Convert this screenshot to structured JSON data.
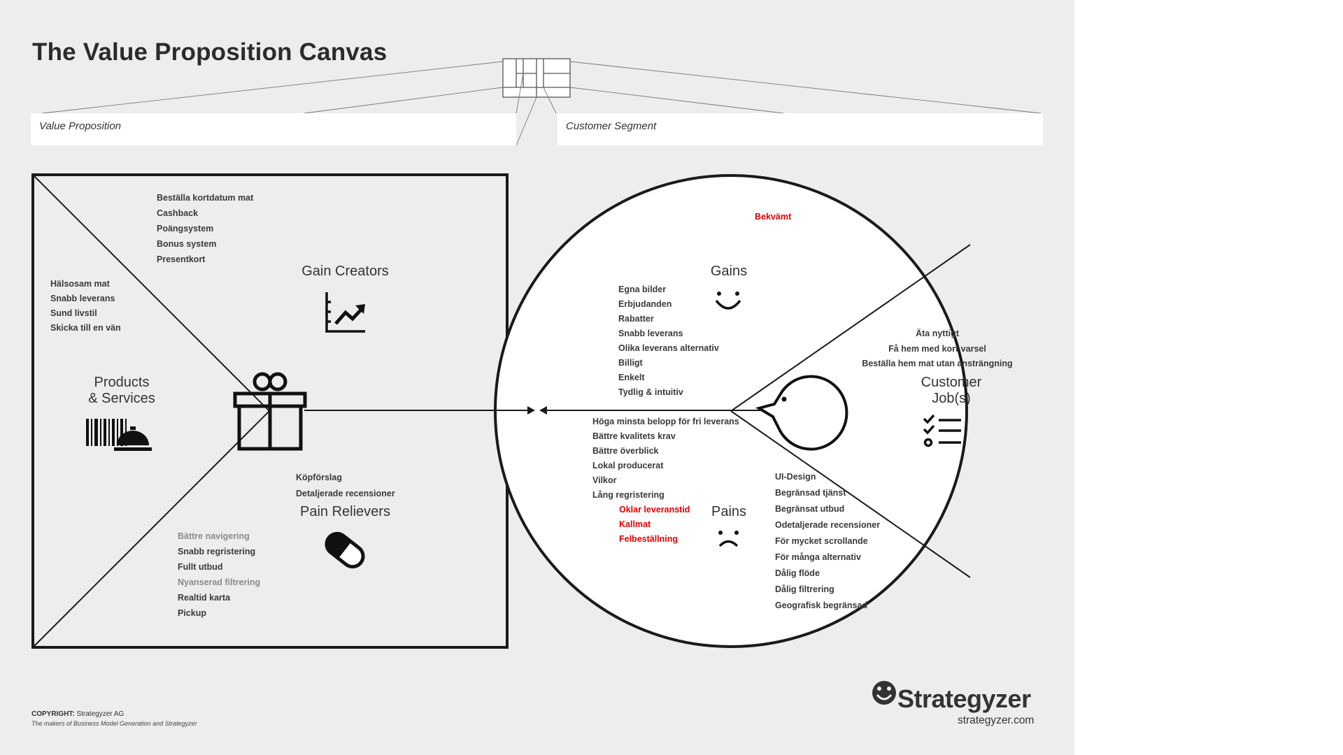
{
  "title": "The Value Proposition Canvas",
  "segments": {
    "value_proposition": "Value Proposition",
    "customer_segment": "Customer Segment"
  },
  "gain_creators": {
    "label": "Gain Creators",
    "top_items": [
      "Beställa kortdatum mat",
      "Cashback",
      "Poängsystem",
      "Bonus system",
      "Presentkort"
    ]
  },
  "products_services": {
    "label_line1": "Products",
    "label_line2": "& Services",
    "items": [
      "Hälsosam mat",
      "Snabb leverans",
      "Sund livstil",
      "Skicka till en vän"
    ]
  },
  "pain_relievers": {
    "label": "Pain Relievers",
    "top_items": [
      "Köpförslag",
      "Detaljerade recensioner"
    ],
    "items": [
      {
        "text": "Bättre navigering",
        "tone": "gray"
      },
      {
        "text": "Snabb regristering",
        "tone": "normal"
      },
      {
        "text": "Fullt utbud",
        "tone": "normal"
      },
      {
        "text": "Nyanserad filtrering",
        "tone": "gray"
      },
      {
        "text": "Realtid karta",
        "tone": "normal"
      },
      {
        "text": "Pickup",
        "tone": "normal"
      }
    ]
  },
  "gains": {
    "label": "Gains",
    "highlight": "Bekvämt",
    "items": [
      "Egna bilder",
      "Erbjudanden",
      "Rabatter",
      "Snabb leverans",
      "Olika leverans alternativ",
      "Billigt",
      "Enkelt",
      "Tydlig & intuitiv"
    ]
  },
  "customer_jobs": {
    "label_line1": "Customer",
    "label_line2": "Job(s)",
    "items": [
      "Äta nyttigt",
      "Få hem med kort varsel",
      "Beställa hem mat utan ansträngning"
    ]
  },
  "pains": {
    "label": "Pains",
    "left_items": [
      "Höga minsta belopp för fri leverans",
      "Bättre kvalitets krav",
      "Bättre överblick",
      "Lokal producerat",
      "Vilkor",
      "Lång regristering"
    ],
    "red_items": [
      "Oklar leveranstid",
      "Kallmat",
      "Felbeställning"
    ],
    "right_items": [
      "UI-Design",
      "Begränsad tjänst",
      "Begränsat utbud",
      "Odetaljerade recensioner",
      "För mycket scrollande",
      "För många alternativ",
      "Dålig flöde",
      "Dålig filtrering",
      "Geografisk begränsad"
    ]
  },
  "footer": {
    "copyright_label": "COPYRIGHT:",
    "copyright_owner": "Strategyzer AG",
    "tagline": "The makers of Business Model Generation and Strategyzer",
    "brand": "Strategyzer",
    "url": "strategyzer.com"
  },
  "colors": {
    "background": "#ededed",
    "ink": "#1a1a1a",
    "highlight": "#e00000"
  }
}
